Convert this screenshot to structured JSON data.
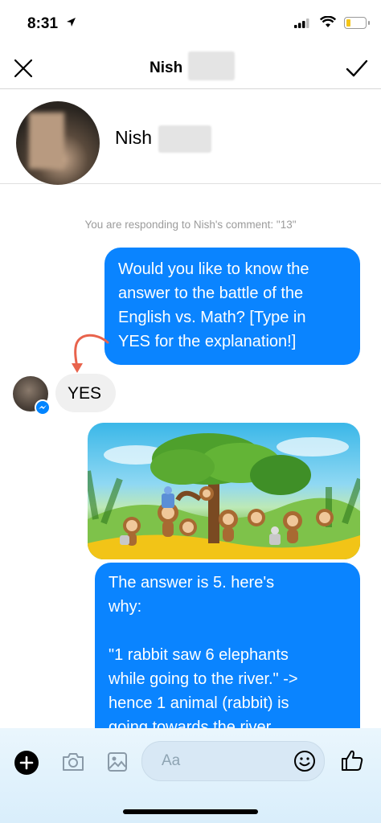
{
  "status_bar": {
    "time": "8:31"
  },
  "header": {
    "title": "Nish"
  },
  "profile": {
    "name": "Nish"
  },
  "conversation": {
    "system_notice": "You are responding to Nish's comment: \"13\"",
    "messages": [
      {
        "direction": "outgoing",
        "text": "Would you like to know the\nanswer to the battle of the\nEnglish vs. Math? [Type in\nYES for the explanation!]"
      },
      {
        "direction": "incoming",
        "text": "YES"
      },
      {
        "direction": "outgoing",
        "type": "image",
        "description": "cartoon-jungle-monkeys-robot"
      },
      {
        "direction": "outgoing",
        "text": "The answer is 5.  here's\nwhy:\n\n\"1 rabbit saw 6 elephants\nwhile going to the river.\" ->\nhence 1 animal (rabbit) is\ngoing towards the river"
      }
    ]
  },
  "composer": {
    "placeholder": "Aa"
  },
  "colors": {
    "accent": "#0a84ff",
    "incoming_bubble": "#f0f0f0",
    "arrow": "#e8634c"
  }
}
